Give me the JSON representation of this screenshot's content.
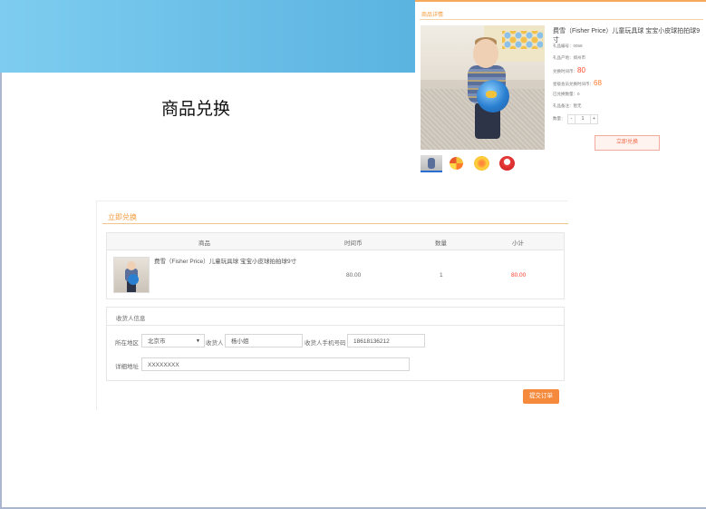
{
  "page": {
    "title": "商品兑换"
  },
  "detail": {
    "section_title": "商品详情",
    "product_name": "费雪（Fisher Price）儿童玩具球 宝宝小皮球拍拍球9寸",
    "info": {
      "item_no": "礼品编号：0059",
      "origin": "礼品产地：郑州市",
      "price_label": "兑换时间币：",
      "price_value": "80",
      "member_label": "星级会员兑换时间币：",
      "member_value": "68",
      "exchanged": "已兑换数量：0",
      "remark": "礼品备注：暂无"
    },
    "quantity": {
      "label": "数量：",
      "minus": "-",
      "value": "1",
      "plus": "+"
    },
    "exchange_button": "立即兑换"
  },
  "order": {
    "section_title": "立即兑换",
    "columns": [
      "商品",
      "时间币",
      "数量",
      "小计"
    ],
    "item": {
      "name": "费雪（Fisher Price）儿童玩具球 宝宝小皮球拍拍球9寸",
      "price": "80.00",
      "qty": "1",
      "subtotal": "80.00"
    },
    "address": {
      "section_title": "收货人信息",
      "region_label": "所在地区",
      "region_value": "北京市",
      "receiver_label": "收货人",
      "receiver_value": "杨小姐",
      "phone_label": "收货人手机号码",
      "phone_value": "18618136212",
      "detail_label": "详细地址",
      "detail_value": "XXXXXXXX"
    },
    "submit_button": "提交订单"
  },
  "colors": {
    "accent": "#f39a3a",
    "price_red": "#ff3b2a",
    "button_orange": "#f58a3c",
    "banner_blue": "#6cc0ea"
  },
  "icons": {
    "dropdown": "chevron-down-icon"
  }
}
